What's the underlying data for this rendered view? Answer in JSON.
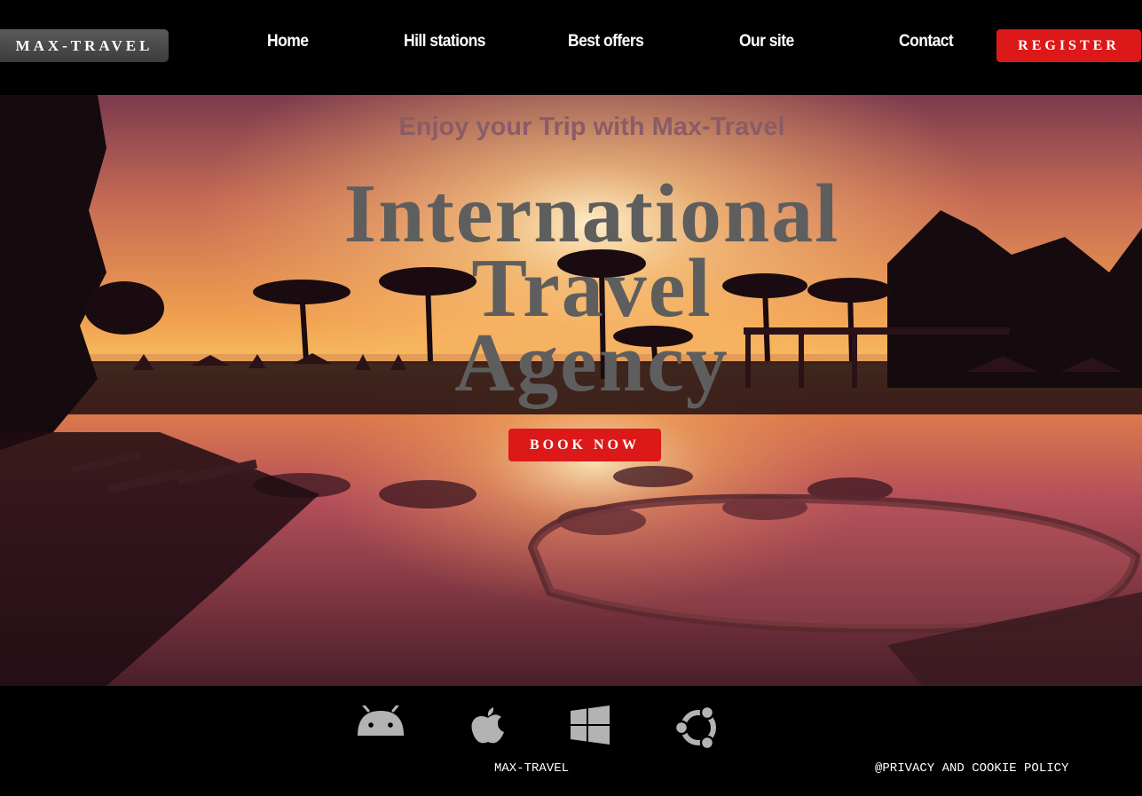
{
  "header": {
    "logo": "MAX-TRAVEL",
    "nav": [
      {
        "label": "Home"
      },
      {
        "label": "Hill stations"
      },
      {
        "label": "Best offers"
      },
      {
        "label": "Our site"
      },
      {
        "label": "Contact"
      }
    ],
    "register_label": "REGISTER"
  },
  "hero": {
    "tagline": "Enjoy your Trip with Max-Travel",
    "title_lines": [
      "International",
      "Travel",
      "Agency"
    ],
    "book_label": "BOOK NOW"
  },
  "footer": {
    "icons": [
      "android-icon",
      "apple-icon",
      "windows-icon",
      "ubuntu-icon"
    ],
    "brand": "MAX-TRAVEL",
    "privacy": "@PRIVACY AND COOKIE POLICY"
  },
  "colors": {
    "accent": "#dd1818",
    "header_bg": "#000000",
    "icon_gray": "#b3b3b3"
  }
}
